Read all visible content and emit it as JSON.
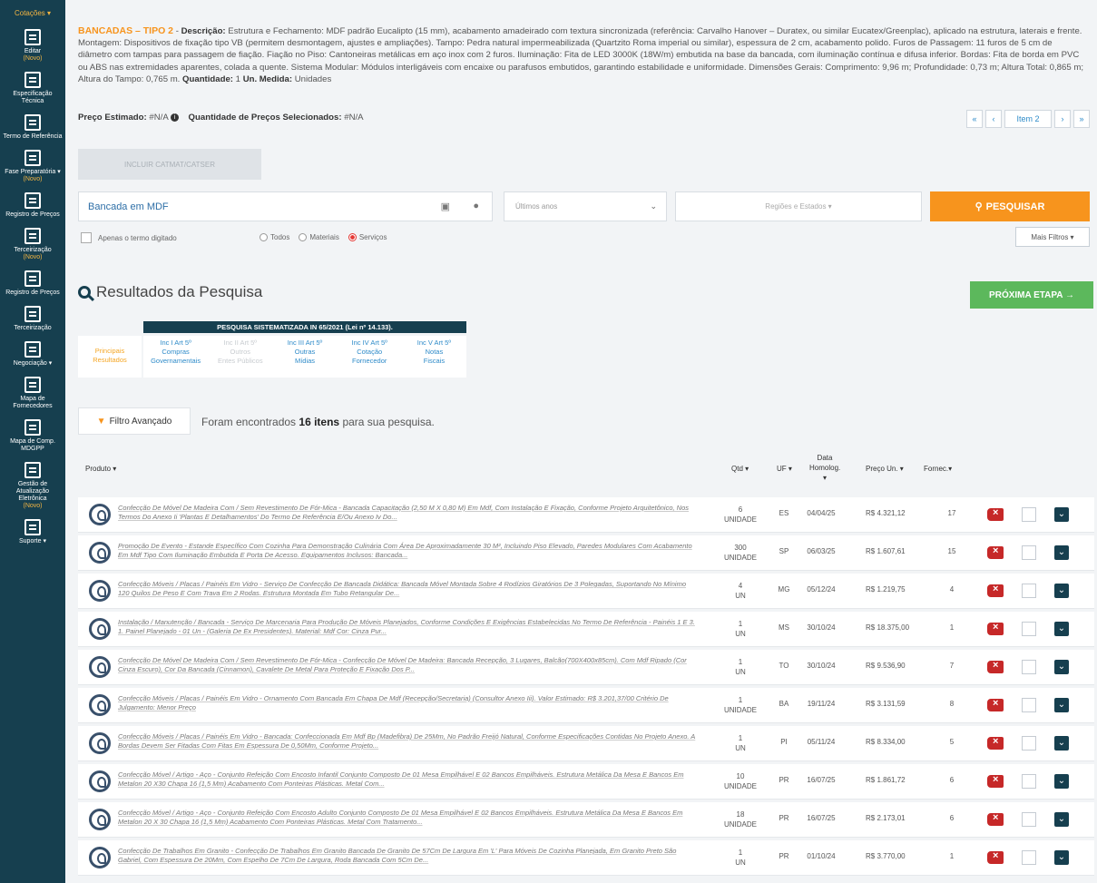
{
  "sidebar": {
    "top_label": "Cotações ▾",
    "items": [
      {
        "icon": "edit-icon",
        "label": "Editar",
        "badge": "(Novo)"
      },
      {
        "icon": "spec-icon",
        "label": "Especificação Técnica",
        "badge": ""
      },
      {
        "icon": "document-icon",
        "label": "Termo de Referência",
        "badge": ""
      },
      {
        "icon": "phase-icon",
        "label": "Fase Preparatória ▾",
        "badge": "(Novo)"
      },
      {
        "icon": "register-icon",
        "label": "Registro de Preços",
        "badge": ""
      },
      {
        "icon": "outsourcing-icon",
        "label": "Terceirização",
        "badge": "(Novo)"
      },
      {
        "icon": "register-icon",
        "label": "Registro de Preços",
        "badge": ""
      },
      {
        "icon": "outsourcing-icon",
        "label": "Terceirização",
        "badge": ""
      },
      {
        "icon": "negotiation-icon",
        "label": "Negociação ▾",
        "badge": ""
      },
      {
        "icon": "map-icon",
        "label": "Mapa de Fornecedores",
        "badge": ""
      },
      {
        "icon": "map-icon",
        "label": "Mapa de Comp. MDGPP",
        "badge": ""
      },
      {
        "icon": "gestao-icon",
        "label": "Gestão de Atualização Eletrônica",
        "badge": "(Novo)"
      },
      {
        "icon": "support-icon",
        "label": "Suporte ▾",
        "badge": ""
      }
    ]
  },
  "item": {
    "title": "BANCADAS – TIPO 2",
    "desc_label": "Descrição:",
    "description": "Estrutura e Fechamento: MDF padrão Eucalipto (15 mm), acabamento amadeirado com textura sincronizada (referência: Carvalho Hanover – Duratex, ou similar Eucatex/Greenplac), aplicado na estrutura, laterais e frente. Montagem: Dispositivos de fixação tipo VB (permitem desmontagem, ajustes e ampliações). Tampo: Pedra natural impermeabilizada (Quartzito Roma imperial ou similar), espessura de 2 cm, acabamento polido. Furos de Passagem: 11 furos de 5 cm de diâmetro com tampas para passagem de fiação. Fiação no Piso: Cantoneiras metálicas em aço inox com 2 furos. Iluminação: Fita de LED 3000K (18W/m) embutida na base da bancada, com iluminação contínua e difusa inferior. Bordas: Fita de borda em PVC ou ABS nas extremidades aparentes, colada a quente. Sistema Modular: Módulos interligáveis com encaixe ou parafusos embutidos, garantindo estabilidade e uniformidade. Dimensões Gerais: Comprimento: 9,96 m; Profundidade: 0,73 m; Altura Total: 0,865 m; Altura do Tampo: 0,765 m.",
    "qty_label": "Quantidade:",
    "qty": "1",
    "unit_label": "Un. Medida:",
    "unit": "Unidades",
    "price_label": "Preço Estimado:",
    "price": "#N/A",
    "selected_label": "Quantidade de Preços Selecionados:",
    "selected": "#N/A"
  },
  "pager": {
    "first": "«",
    "prev": "‹",
    "current": "Item 2",
    "next": "›",
    "last": "»"
  },
  "disabled_button": "INCLUIR CATMAT/CATSER",
  "search": {
    "value": "Bancada em MDF",
    "filter_placeholder": "Últimos anos",
    "regions_placeholder": "Regiões e Estados ▾",
    "button": "PESQUISAR",
    "exact_label": "Apenas o termo digitado",
    "radios": [
      "Todos",
      "Materiais",
      "Serviços"
    ],
    "selected_radio": "Serviços",
    "more_filters": "Mais Filtros ▾"
  },
  "results": {
    "title": "Resultados da Pesquisa",
    "next_button": "PRÓXIMA ETAPA →",
    "sys_header": "PESQUISA SISTEMATIZADA IN 65/2021 (Lei nº 14.133).",
    "sys_left": "Principais Resultados",
    "sys_cols": [
      {
        "a": "Inc I Art 5º",
        "b": "Compras",
        "c": "Governamentais",
        "enabled": true
      },
      {
        "a": "Inc II Art 5º",
        "b": "Outros",
        "c": "Entes Públicos",
        "enabled": false
      },
      {
        "a": "Inc III Art 5º",
        "b": "Outras",
        "c": "Mídias",
        "enabled": true
      },
      {
        "a": "Inc IV Art 5º",
        "b": "Cotação",
        "c": "Fornecedor",
        "enabled": true
      },
      {
        "a": "Inc V Art 5º",
        "b": "Notas",
        "c": "Fiscais",
        "enabled": true
      }
    ],
    "adv_filter": "Filtro Avançado",
    "found_prefix": "Foram encontrados",
    "found_count": "16 itens",
    "found_suffix": "para sua pesquisa."
  },
  "table": {
    "headers": {
      "produto": "Produto ▾",
      "qtd": "Qtd ▾",
      "uf": "UF ▾",
      "data": "Data Homolog. ▾",
      "preco": "Preço Un. ▾",
      "fornec": "Fornec.▾"
    },
    "rows": [
      {
        "produto": "Confecção De Móvel De Madeira Com / Sem Revestimento De Fór-Mica - Bancada Capacitação (2,50 M X 0,80 M) Em Mdf, Com Instalação E Fixação, Conforme Projeto Arquitetônico, Nos Termos Do Anexo Ii 'Plantas E Detalhamentos' Do Termo De Referência E/Ou Anexo Iv Do...",
        "qtd": "6",
        "un": "UNIDADE",
        "uf": "ES",
        "data": "04/04/25",
        "preco": "R$ 4.321,12",
        "fornec": "17"
      },
      {
        "produto": "Promoção De Evento - Estande Específico Com Cozinha Para Demonstração Culinária Com Área De Aproximadamente 30 M², Incluindo Piso Elevado, Paredes Modulares Com Acabamento Em Mdf Tipo Com Iluminação Embutida E Porta De Acesso. Equipamentos Inclusos: Bancada...",
        "qtd": "300",
        "un": "UNIDADE",
        "uf": "SP",
        "data": "06/03/25",
        "preco": "R$ 1.607,61",
        "fornec": "15"
      },
      {
        "produto": "Confecção Móveis / Placas / Painéis Em Vidro - Serviço De Confecção De Bancada Didática: Bancada Móvel Montada Sobre 4 Rodízios Giratórios De 3 Polegadas, Suportando No Mínimo 120 Quilos De Peso E Com Trava Em 2 Rodas. Estrutura Montada Em Tubo Retangular De...",
        "qtd": "4",
        "un": "UN",
        "uf": "MG",
        "data": "05/12/24",
        "preco": "R$ 1.219,75",
        "fornec": "4"
      },
      {
        "produto": "Instalação / Manutenção / Bancada - Serviço De Marcenaria Para Produção De Móveis Planejados, Conforme Condições E Exigências Estabelecidas No Termo De Referência - Painéis 1 E 3. 1. Painel Planejado - 01 Un - (Galeria De Ex Presidentes). Material: Mdf Cor: Cinza Pur...",
        "qtd": "1",
        "un": "UN",
        "uf": "MS",
        "data": "30/10/24",
        "preco": "R$ 18.375,00",
        "fornec": "1"
      },
      {
        "produto": "Confecção De Móvel De Madeira Com / Sem Revestimento De Fór-Mica - Confecção De Móvel De Madeira: Bancada Recepção, 3 Lugares, Balcão(700X400x85cm). Com Mdf Ripado (Cor Cinza Escuro), Cor Da Bancada (Cinnamon), Cavalete De Metal Para Proteção E Fixação Dos P...",
        "qtd": "1",
        "un": "UN",
        "uf": "TO",
        "data": "30/10/24",
        "preco": "R$ 9.536,90",
        "fornec": "7"
      },
      {
        "produto": "Confecção Móveis / Placas / Painéis Em Vidro - Ornamento Com Bancada Em Chapa De Mdf (Recepção/Secretaria) (Consultor Anexo Iii). Valor Estimado: R$ 3.201,37/00 Critério De Julgamento: Menor Preço",
        "qtd": "1",
        "un": "UNIDADE",
        "uf": "BA",
        "data": "19/11/24",
        "preco": "R$ 3.131,59",
        "fornec": "8"
      },
      {
        "produto": "Confecção Móveis / Placas / Painéis Em Vidro - Bancada: Confeccionada Em Mdf Bp (Madefibra) De 25Mm, No Padrão Freijó Natural, Conforme Especificações Contidas No Projeto Anexo. A Bordas Devem Ser Fitadas Com Fitas Em Espessura De 0,50Mm, Conforme Projeto...",
        "qtd": "1",
        "un": "UN",
        "uf": "PI",
        "data": "05/11/24",
        "preco": "R$ 8.334,00",
        "fornec": "5"
      },
      {
        "produto": "Confecção Móvel / Artigo - Aço - Conjunto Refeição Com Encosto Infantil Conjunto Composto De 01 Mesa Empilhável E 02 Bancos Empilháveis. Estrutura Metálica Da Mesa E Bancos Em Metalon 20 X30 Chapa 16 (1,5 Mm) Acabamento Com Ponteiras Plásticas. Metal Com...",
        "qtd": "10",
        "un": "UNIDADE",
        "uf": "PR",
        "data": "16/07/25",
        "preco": "R$ 1.861,72",
        "fornec": "6"
      },
      {
        "produto": "Confecção Móvel / Artigo - Aço - Conjunto Refeição Com Encosto Adulto Conjunto Composto De 01 Mesa Empilhável E 02 Bancos Empilháveis. Estrutura Metálica Da Mesa E Bancos Em Metalon 20 X 30 Chapa 16 (1,5 Mm) Acabamento Com Ponteiras Plásticas. Metal Com Tratamento...",
        "qtd": "18",
        "un": "UNIDADE",
        "uf": "PR",
        "data": "16/07/25",
        "preco": "R$ 2.173,01",
        "fornec": "6"
      },
      {
        "produto": "Confecção De Trabalhos Em Granito - Confecção De Trabalhos Em Granito Bancada De Granito De 57Cm De Largura Em 'L' Para Móveis De Cozinha Planejada, Em Granito Preto São Gabriel, Com Espessura De 20Mm, Com Espelho De 7Cm De Largura, Roda Bancada Com 5Cm De...",
        "qtd": "1",
        "un": "UN",
        "uf": "PR",
        "data": "01/10/24",
        "preco": "R$ 3.770,00",
        "fornec": "1"
      }
    ]
  },
  "colors": {
    "sidebar": "#163f4f",
    "accent": "#f7941d",
    "success": "#5cb85c",
    "danger": "#c62828"
  }
}
